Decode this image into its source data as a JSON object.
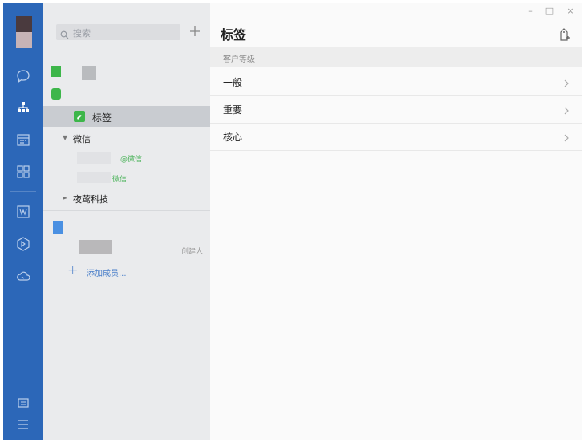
{
  "colors": {
    "rail": "#2c67b8",
    "middle_panel": "#eaebed",
    "selected_row": "#c9ccd1",
    "main_bg": "#fafafa",
    "accent_green": "#3db64a",
    "link_blue": "#4a7fc9"
  },
  "sidebar": {
    "icons": [
      "chat-icon",
      "org-structure-icon",
      "calendar-icon",
      "apps-grid-icon",
      "docs-icon",
      "drive-icon",
      "cloud-icon",
      "mail-icon",
      "menu-icon"
    ]
  },
  "search": {
    "placeholder": "搜索"
  },
  "contacts": {
    "tag_item": "标签",
    "groups": [
      {
        "name": "微信",
        "expanded": true
      },
      {
        "name": "夜莺科技",
        "expanded": false
      }
    ],
    "wechat_sub": [
      "@微信",
      "微信"
    ],
    "creator_label": "创建人",
    "add_member": "添加成员..."
  },
  "window_controls": [
    "–",
    "□",
    "×"
  ],
  "main": {
    "title": "标签",
    "section": "客户等级",
    "items": [
      "一般",
      "重要",
      "核心"
    ]
  }
}
